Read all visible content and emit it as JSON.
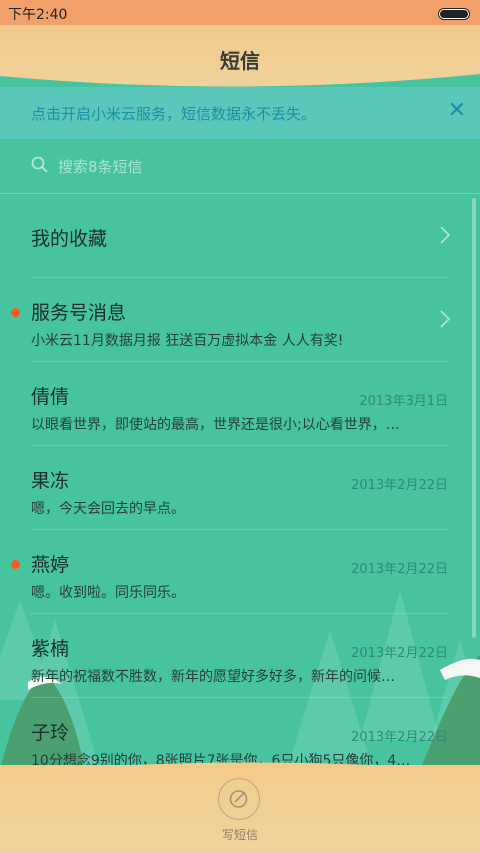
{
  "status_bar": {
    "time": "下午2:40"
  },
  "header": {
    "title": "短信"
  },
  "banner": {
    "text": "点击开启小米云服务，短信数据永不丢失。",
    "close_icon": "close-icon"
  },
  "search": {
    "placeholder": "搜索8条短信"
  },
  "threads": [
    {
      "name": "我的收藏",
      "preview": "",
      "date": "",
      "unread": false,
      "chevron": true
    },
    {
      "name": "服务号消息",
      "preview": "小米云11月数据月报 狂送百万虚拟本金 人人有奖!",
      "date": "",
      "unread": true,
      "chevron": true
    },
    {
      "name": "倩倩",
      "preview": "以眼看世界，即使站的最高，世界还是很小;以心看世界，…",
      "date": "2013年3月1日",
      "unread": false,
      "chevron": false
    },
    {
      "name": "果冻",
      "preview": "嗯，今天会回去的早点。",
      "date": "2013年2月22日",
      "unread": false,
      "chevron": false
    },
    {
      "name": "燕婷",
      "preview": "嗯。收到啦。同乐同乐。",
      "date": "2013年2月22日",
      "unread": true,
      "chevron": false
    },
    {
      "name": "紫楠",
      "preview": "新年的祝福数不胜数，新年的愿望好多好多，新年的问候…",
      "date": "2013年2月22日",
      "unread": false,
      "chevron": false
    },
    {
      "name": "子玲",
      "preview": "10分想念9别的你，8张照片7张是你，6只小狗5只像你，4…",
      "date": "2013年2月22日",
      "unread": false,
      "chevron": false
    }
  ],
  "compose": {
    "label": "写短信"
  },
  "colors": {
    "accent": "#47c3a0",
    "header": "#f1ca8b",
    "unread_dot": "#ff5a1f"
  }
}
